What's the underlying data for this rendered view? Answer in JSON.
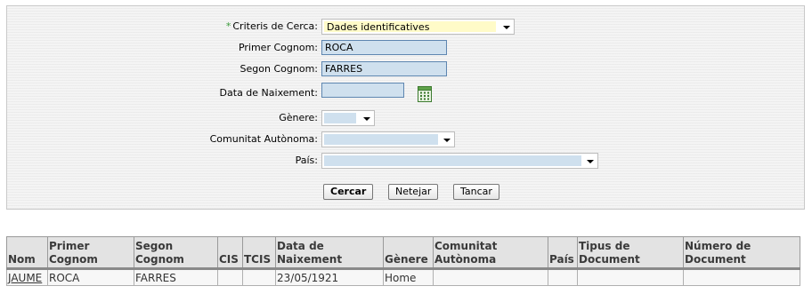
{
  "search": {
    "criteria": {
      "label": "Criteris de Cerca:",
      "required_mark": "*",
      "value": "Dades identificatives"
    },
    "primer_cognom": {
      "label": "Primer Cognom:",
      "value": "ROCA"
    },
    "segon_cognom": {
      "label": "Segon Cognom:",
      "value": "FARRES"
    },
    "data_naixement": {
      "label": "Data de Naixement:",
      "value": ""
    },
    "genere": {
      "label": "Gènere:",
      "value": ""
    },
    "comunitat": {
      "label": "Comunitat Autònoma:",
      "value": ""
    },
    "pais": {
      "label": "País:",
      "value": ""
    },
    "buttons": {
      "search": "Cercar",
      "clear": "Netejar",
      "close": "Tancar"
    },
    "icons": {
      "calendar": "calendar-icon",
      "dropdown": "chevron-down-icon"
    }
  },
  "results": {
    "headers": [
      {
        "line1": "",
        "line2": "Nom"
      },
      {
        "line1": "Primer",
        "line2": "Cognom"
      },
      {
        "line1": "Segon",
        "line2": "Cognom"
      },
      {
        "line1": "",
        "line2": "CIS"
      },
      {
        "line1": "",
        "line2": "TCIS"
      },
      {
        "line1": "Data de",
        "line2": "Naixement"
      },
      {
        "line1": "",
        "line2": "Gènere"
      },
      {
        "line1": "Comunitat",
        "line2": "Autònoma"
      },
      {
        "line1": "",
        "line2": "País"
      },
      {
        "line1": "Tipus de",
        "line2": "Document"
      },
      {
        "line1": "Número de",
        "line2": "Document"
      }
    ],
    "rows": [
      [
        "JAUME",
        "ROCA",
        "FARRES",
        "",
        "",
        "23/05/1921",
        "Home",
        "",
        "",
        "",
        ""
      ]
    ]
  },
  "colors": {
    "field_fill": "#cfe0ee",
    "field_border": "#5e86b0",
    "criteria_fill": "#fffbc8",
    "required": "#3a9a3a"
  }
}
